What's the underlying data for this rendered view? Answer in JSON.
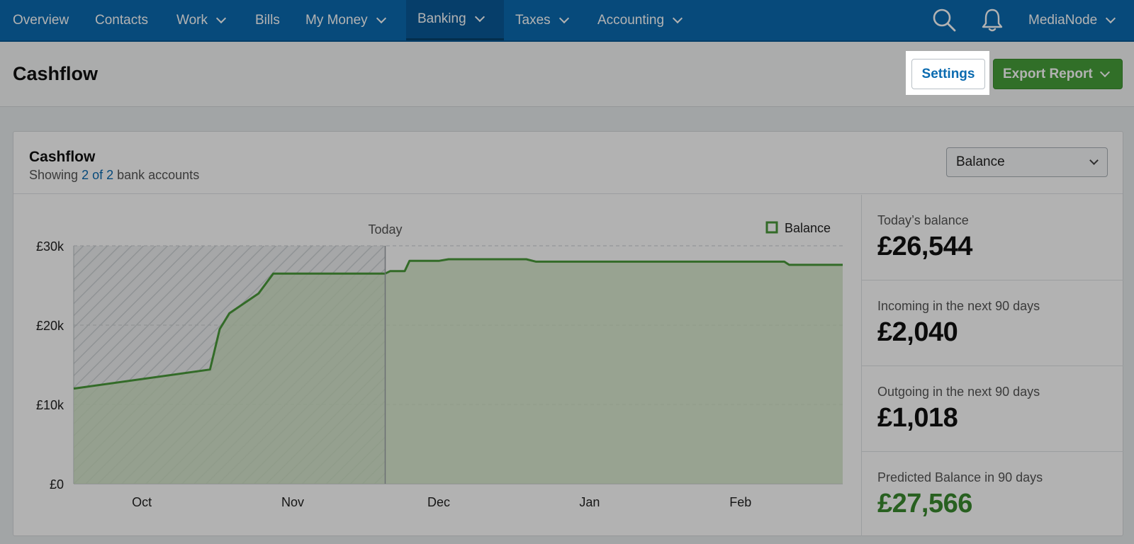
{
  "nav": {
    "items": [
      {
        "label": "Overview",
        "dropdown": false
      },
      {
        "label": "Contacts",
        "dropdown": false
      },
      {
        "label": "Work",
        "dropdown": true
      },
      {
        "label": "Bills",
        "dropdown": false
      },
      {
        "label": "My Money",
        "dropdown": true
      },
      {
        "label": "Banking",
        "dropdown": true,
        "active": true
      },
      {
        "label": "Taxes",
        "dropdown": true
      },
      {
        "label": "Accounting",
        "dropdown": true
      }
    ],
    "account": "MediaNode",
    "icons": [
      "search-icon",
      "bell-icon"
    ]
  },
  "page": {
    "title": "Cashflow",
    "settings_label": "Settings",
    "export_label": "Export Report"
  },
  "card": {
    "title": "Cashflow",
    "sub_prefix": "Showing ",
    "sub_link": "2 of 2",
    "sub_suffix": " bank accounts",
    "select_value": "Balance"
  },
  "stats": [
    {
      "label": "Today’s balance",
      "value": "£26,544",
      "highlight": false
    },
    {
      "label": "Incoming in the next 90 days",
      "value": "£2,040",
      "highlight": false
    },
    {
      "label": "Outgoing in the next 90 days",
      "value": "£1,018",
      "highlight": false
    },
    {
      "label": "Predicted Balance in 90 days",
      "value": "£27,566",
      "highlight": true
    }
  ],
  "colors": {
    "nav": "#0b6bb0",
    "accent": "#47a03a",
    "line": "#4a9a3a",
    "fill": "#cde3c0"
  },
  "chart_data": {
    "type": "area",
    "legend": [
      "Balance"
    ],
    "legend_position": "top-right",
    "today_label": "Today",
    "yticks": [
      "£0",
      "£10k",
      "£20k",
      "£30k"
    ],
    "ylim": [
      0,
      30000
    ],
    "xticks": [
      "Oct",
      "Nov",
      "Dec",
      "Jan",
      "Feb"
    ],
    "xlim": [
      "2023-09-17",
      "2024-02-22"
    ],
    "today": "2023-11-20",
    "series": [
      {
        "name": "Balance",
        "x": [
          "2023-09-17",
          "2023-10-15",
          "2023-10-17",
          "2023-10-19",
          "2023-10-25",
          "2023-10-28",
          "2023-11-20",
          "2023-11-21",
          "2023-11-24",
          "2023-11-25",
          "2023-12-01",
          "2023-12-03",
          "2023-12-19",
          "2023-12-21",
          "2024-02-10",
          "2024-02-11",
          "2024-02-22"
        ],
        "values": [
          12000,
          14400,
          19500,
          21500,
          24000,
          26500,
          26500,
          26800,
          26800,
          28100,
          28100,
          28300,
          28300,
          28000,
          28000,
          27600,
          27600
        ]
      }
    ]
  }
}
